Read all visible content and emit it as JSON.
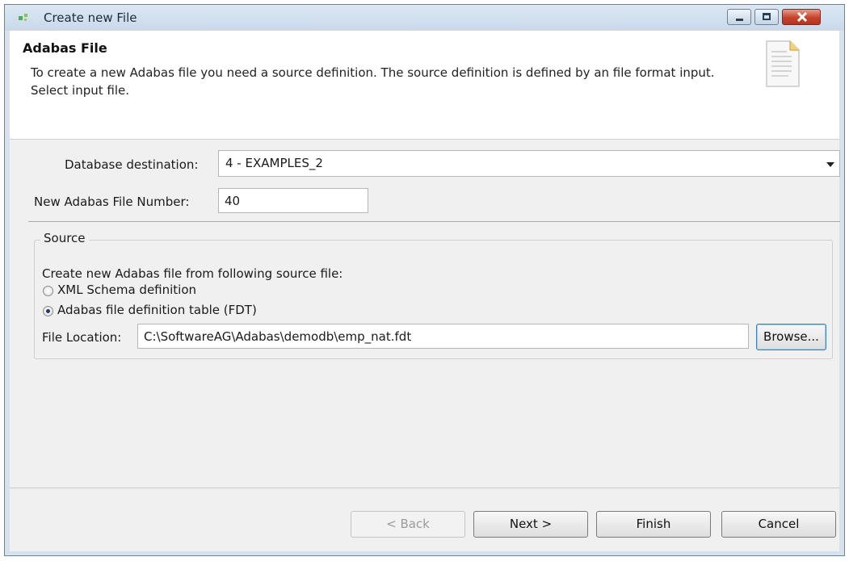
{
  "window": {
    "title": "Create new File"
  },
  "header": {
    "title": "Adabas File",
    "description": "To create a new Adabas file you need a source definition. The source definition is defined by an file format input. Select input file."
  },
  "form": {
    "db_dest_label": "Database destination:",
    "db_dest_value": "4 - EXAMPLES_2",
    "file_number_label": "New Adabas File Number:",
    "file_number_value": "40"
  },
  "source": {
    "group_title": "Source",
    "instruction": "Create new Adabas file from following source file:",
    "options": [
      {
        "label": "XML Schema definition",
        "selected": false
      },
      {
        "label": "Adabas file definition table (FDT)",
        "selected": true
      }
    ],
    "file_location_label": "File Location:",
    "file_location_value": "C:\\SoftwareAG\\Adabas\\demodb\\emp_nat.fdt",
    "browse_label": "Browse..."
  },
  "buttons": {
    "back": "< Back",
    "next": "Next >",
    "finish": "Finish",
    "cancel": "Cancel"
  }
}
